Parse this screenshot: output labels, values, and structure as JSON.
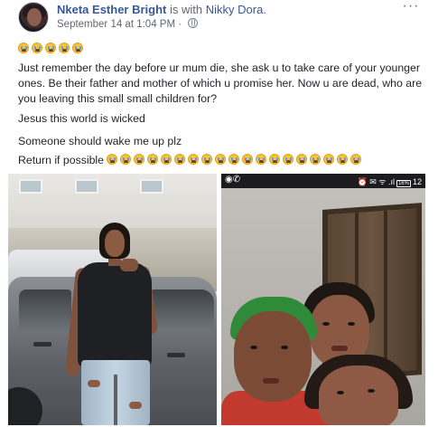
{
  "post": {
    "author_name": "Nketa Esther Bright",
    "with_text": "is with",
    "tagged_name": "Nikky Dora",
    "trailing_period": ".",
    "timestamp": "September 14 at 1:04 PM",
    "meta_separator": "·",
    "more_label": "···",
    "paragraph": "Just remember the day before ur mum die, she ask u to take care of your younger ones. Be their father and mother of which u promise her. Now u are dead, who are you leaving this small small children for?",
    "line_jesus": "Jesus this world is wicked",
    "line_wake": "Someone should wake me up plz",
    "line_return": "Return if possible",
    "top_emoji_count": 5,
    "return_emoji_count": 19
  },
  "phone_status": {
    "left_icons": "◉✆",
    "right_text": "⏰ ✉ ᯤ .ıl",
    "battery_label": "16%",
    "time": "12"
  },
  "icons": {
    "privacy": "globe-icon",
    "emoji": "crying-face-emoji"
  }
}
